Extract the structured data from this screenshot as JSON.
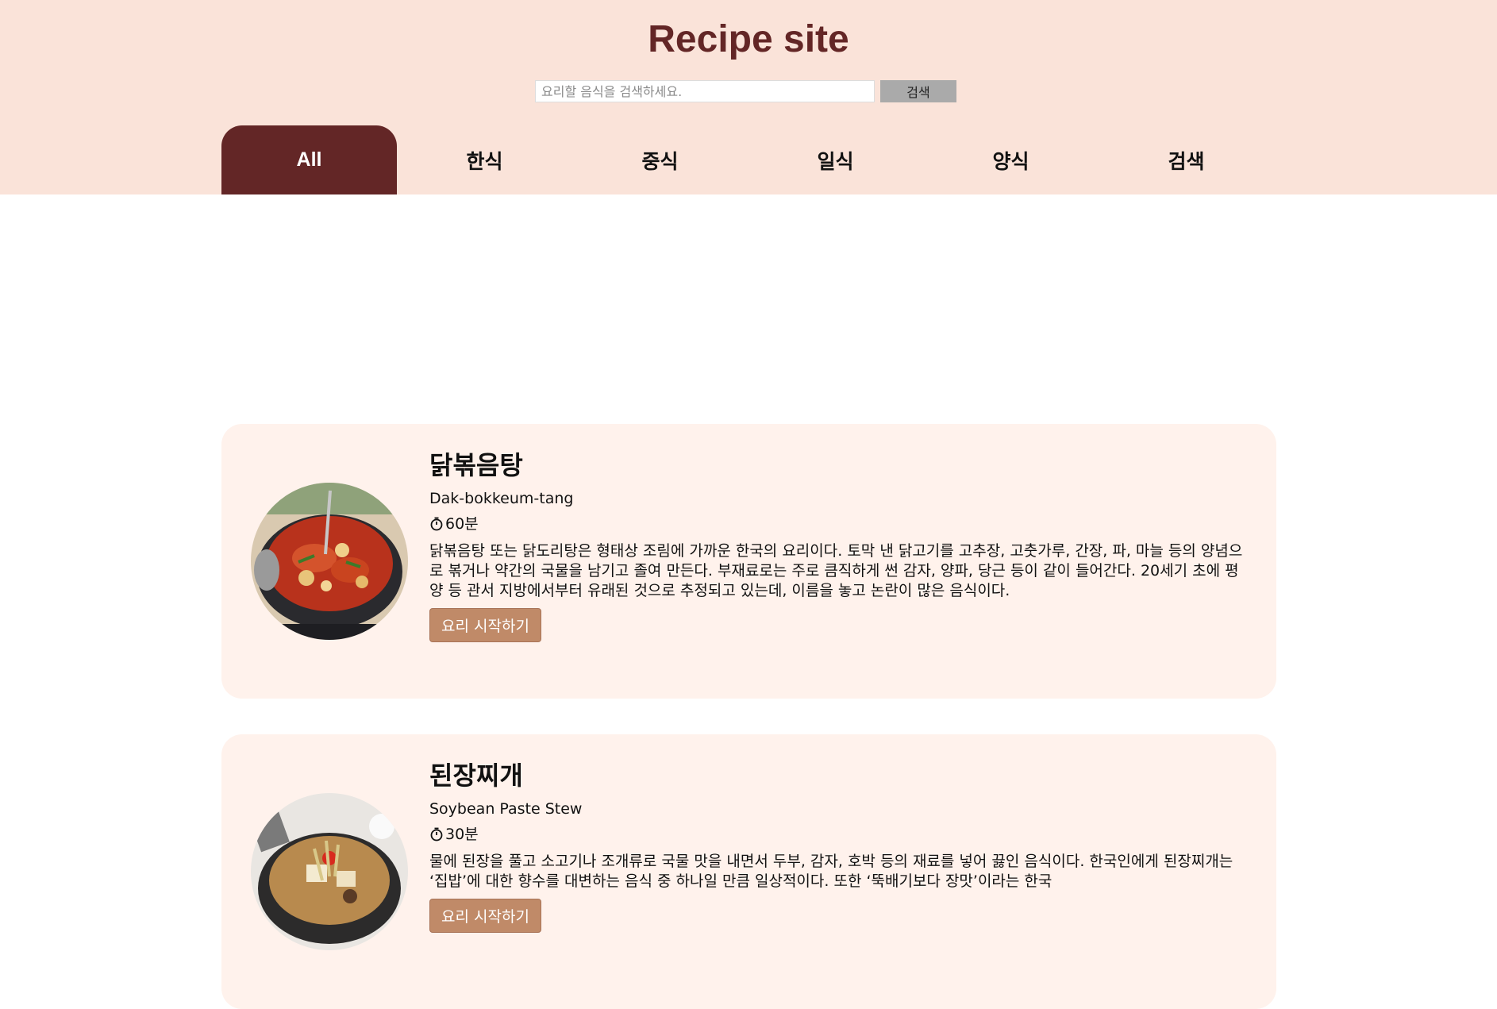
{
  "header": {
    "title": "Recipe site",
    "search": {
      "placeholder": "요리할 음식을 검색하세요.",
      "value": "",
      "button_label": "검색"
    }
  },
  "tabs": [
    {
      "label": "All",
      "active": true
    },
    {
      "label": "한식"
    },
    {
      "label": "중식"
    },
    {
      "label": "일식"
    },
    {
      "label": "양식"
    },
    {
      "label": "검색"
    }
  ],
  "recipes": [
    {
      "name": "닭볶음탕",
      "english_name": "Dak-bokkeum-tang",
      "time": "60분",
      "description": "닭볶음탕 또는 닭도리탕은 형태상 조림에 가까운 한국의 요리이다. 토막 낸 닭고기를 고추장, 고춧가루, 간장, 파, 마늘 등의 양념으로 볶거나 약간의 국물을 남기고 졸여 만든다. 부재료로는 주로 큼직하게 썬 감자, 양파, 당근 등이 같이 들어간다. 20세기 초에 평양 등 관서 지방에서부터 유래된 것으로 추정되고 있는데, 이름을 놓고 논란이 많은 음식이다.",
      "button_label": "요리 시작하기",
      "image_icon": "braised-chicken-photo"
    },
    {
      "name": "된장찌개",
      "english_name": "Soybean Paste Stew",
      "time": "30분",
      "description": "물에 된장을 풀고 소고기나 조개류로 국물 맛을 내면서 두부, 감자, 호박 등의 재료를 넣어 끓인 음식이다. 한국인에게 된장찌개는 ‘집밥’에 대한 향수를 대변하는 음식 중 하나일 만큼 일상적이다. 또한 ‘뚝배기보다 장맛’이라는 한국",
      "button_label": "요리 시작하기",
      "image_icon": "soybean-stew-photo"
    }
  ],
  "colors": {
    "brand": "#632626",
    "header_bg": "#fae3d9",
    "card_bg": "#fff2ec",
    "button": "#c08a68"
  }
}
